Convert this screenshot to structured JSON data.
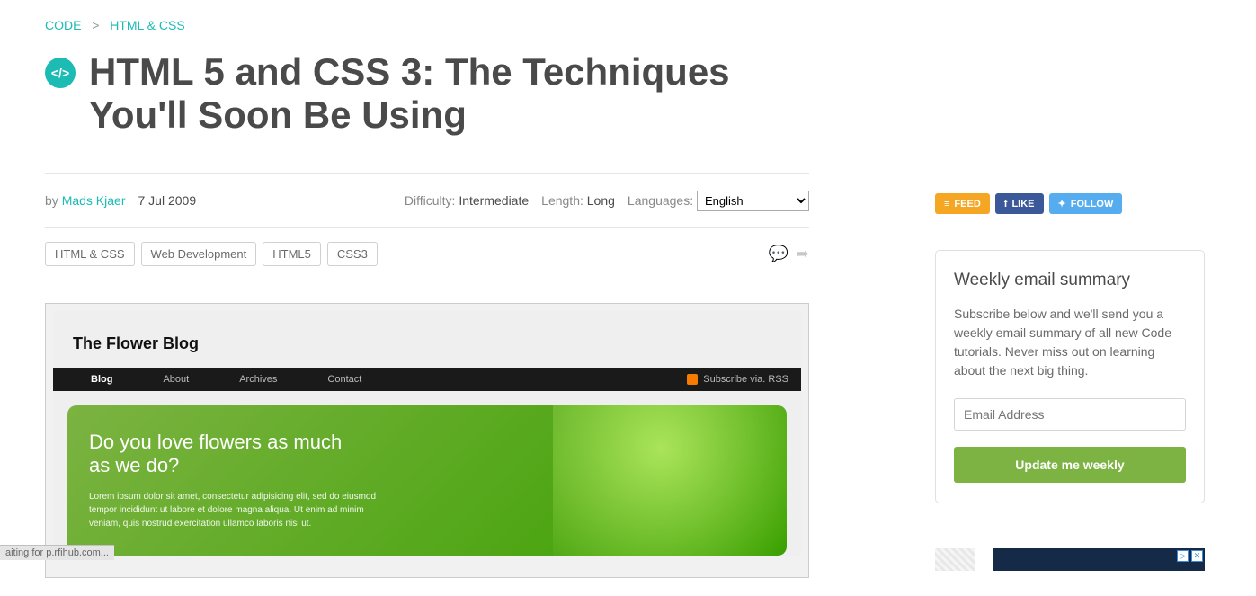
{
  "breadcrumb": {
    "item1": "CODE",
    "item2": "HTML & CSS"
  },
  "title": "HTML 5 and CSS 3: The Techniques You'll Soon Be Using",
  "meta": {
    "by": "by",
    "author": "Mads Kjaer",
    "date": "7 Jul 2009",
    "difficulty_label": "Difficulty:",
    "difficulty": "Intermediate",
    "length_label": "Length:",
    "length": "Long",
    "languages_label": "Languages:",
    "language_selected": "English"
  },
  "tags": [
    "HTML & CSS",
    "Web Development",
    "HTML5",
    "CSS3"
  ],
  "hero": {
    "blog_title": "The Flower Blog",
    "nav": [
      "Blog",
      "About",
      "Archives",
      "Contact"
    ],
    "rss": "Subscribe via. RSS",
    "heading": "Do you love flowers as much as we do?",
    "lorem": "Lorem ipsum dolor sit amet, consectetur adipisicing elit, sed do eiusmod tempor incididunt ut labore et dolore magna aliqua. Ut enim ad minim veniam, quis nostrud exercitation ullamco laboris nisi ut."
  },
  "social": {
    "feed": "FEED",
    "like": "LIKE",
    "follow": "FOLLOW"
  },
  "newsletter": {
    "heading": "Weekly email summary",
    "body": "Subscribe below and we'll send you a weekly email summary of all new Code tutorials. Never miss out on learning about the next big thing.",
    "placeholder": "Email Address",
    "button": "Update me weekly"
  },
  "status": "aiting for p.rfihub.com..."
}
